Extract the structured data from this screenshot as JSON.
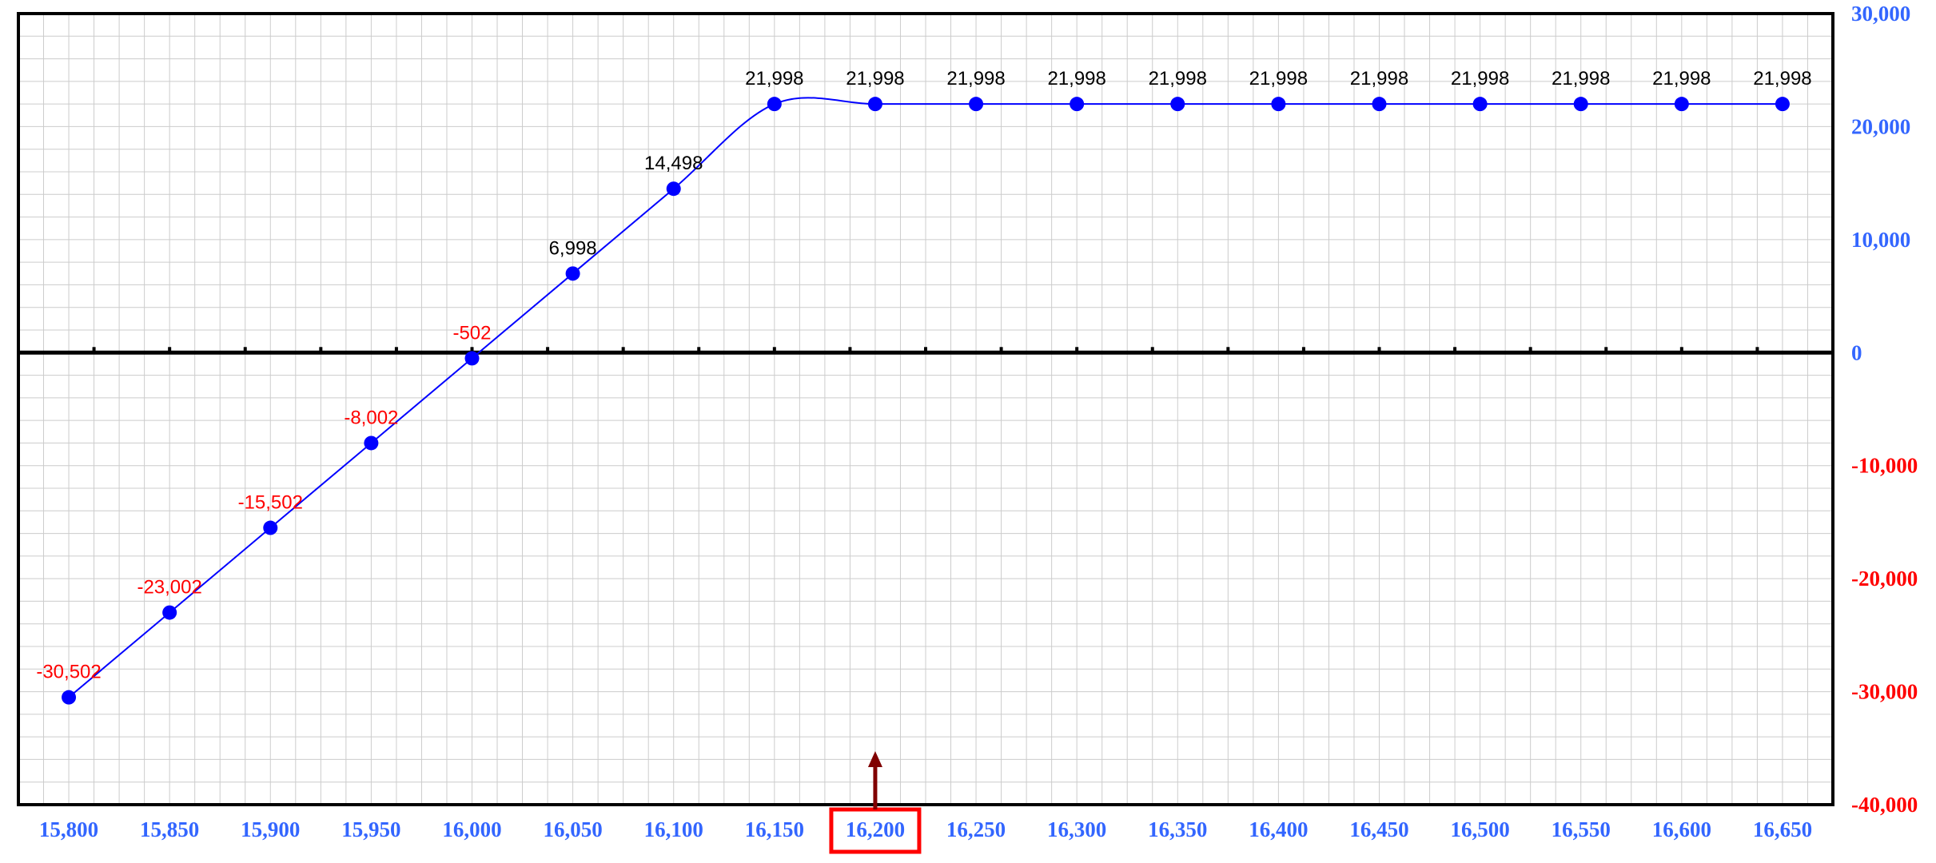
{
  "chart_data": {
    "type": "line",
    "title": "",
    "xlabel": "",
    "ylabel": "",
    "x": [
      15800,
      15850,
      15900,
      15950,
      16000,
      16050,
      16100,
      16150,
      16200,
      16250,
      16300,
      16350,
      16400,
      16450,
      16500,
      16550,
      16600,
      16650
    ],
    "x_tick_labels": [
      "15,800",
      "15,850",
      "15,900",
      "15,950",
      "16,000",
      "16,050",
      "16,100",
      "16,150",
      "16,200",
      "16,250",
      "16,300",
      "16,350",
      "16,400",
      "16,450",
      "16,500",
      "16,550",
      "16,600",
      "16,650"
    ],
    "series": [
      {
        "values": [
          -30502,
          -23002,
          -15502,
          -8002,
          -502,
          6998,
          14498,
          21998,
          21998,
          21998,
          21998,
          21998,
          21998,
          21998,
          21998,
          21998,
          21998,
          21998
        ],
        "labels": [
          "-30,502",
          "-23,002",
          "-15,502",
          "-8,002",
          "-502",
          "6,998",
          "14,498",
          "21,998",
          "21,998",
          "21,998",
          "21,998",
          "21,998",
          "21,998",
          "21,998",
          "21,998",
          "21,998",
          "21,998",
          "21,998"
        ],
        "color": "#0000ff"
      }
    ],
    "y_ticks": [
      30000,
      20000,
      10000,
      0,
      -10000,
      -20000,
      -30000,
      -40000
    ],
    "y_tick_labels": [
      "30,000",
      "20,000",
      "10,000",
      "0",
      "-10,000",
      "-20,000",
      "-30,000",
      "-40,000"
    ],
    "ylim": [
      -40000,
      30000
    ],
    "xlim": [
      15775,
      16675
    ],
    "y_axis_position": "right",
    "grid": true,
    "legend": "none",
    "highlighted_x_label": "16,200",
    "current_price_marker_x": 16200,
    "colors": {
      "line": "#0000ff",
      "marker": "#0000ff",
      "positive_label": "#000000",
      "negative_label": "#ff0000",
      "positive_tick": "#3366ff",
      "negative_tick": "#ff0000",
      "x_tick": "#3366ff",
      "grid": "#cccccc",
      "frame": "#000000",
      "highlight_box": "#ff0000",
      "arrow": "#800000"
    }
  }
}
